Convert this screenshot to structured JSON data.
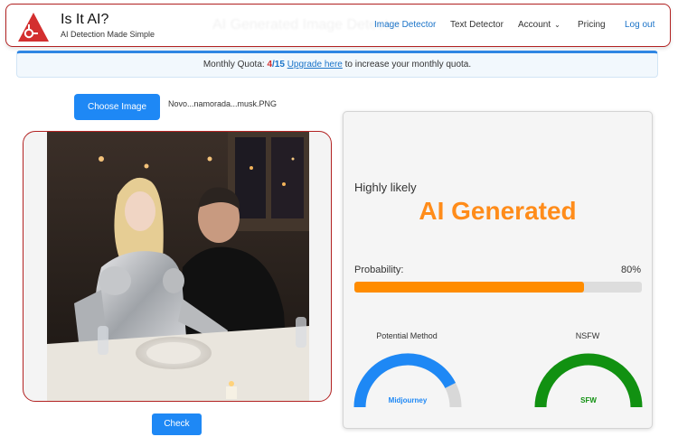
{
  "brand": {
    "title": "Is It AI?",
    "subtitle": "AI Detection Made Simple"
  },
  "header": {
    "ghost_title": "AI Generated Image Detector"
  },
  "nav": {
    "items": [
      {
        "label": "Image Detector"
      },
      {
        "label": "Text Detector"
      },
      {
        "label": "Account"
      },
      {
        "label": "Pricing"
      },
      {
        "label": "Log out"
      }
    ]
  },
  "quota": {
    "prefix": "Monthly Quota: ",
    "used": "4",
    "separator": "/",
    "total": "15",
    "upgrade_label": "Upgrade here",
    "suffix": " to increase your monthly quota."
  },
  "upload": {
    "choose_label": "Choose Image",
    "filename": "Novo...namorada...musk.PNG"
  },
  "check_label": "Check",
  "result": {
    "likelihood": "Highly likely",
    "verdict": "AI Generated",
    "probability_label": "Probability:",
    "probability_text": "80%",
    "probability_value": 0.8,
    "method_title": "Potential Method",
    "method_value": "Midjourney",
    "method_level": 0.85,
    "nsfw_title": "NSFW",
    "nsfw_value": "SFW",
    "nsfw_level": 1.0
  },
  "colors": {
    "accent": "#1e88f5",
    "verdict": "#ff8c1a",
    "probability_fill": "#ff8c00",
    "method_gauge": "#1e88f5",
    "nsfw_gauge": "#119111",
    "frame_border": "#b22222"
  },
  "icons": {
    "logo": "warning-triangle-logo",
    "account_caret": "chevron-down-icon"
  }
}
